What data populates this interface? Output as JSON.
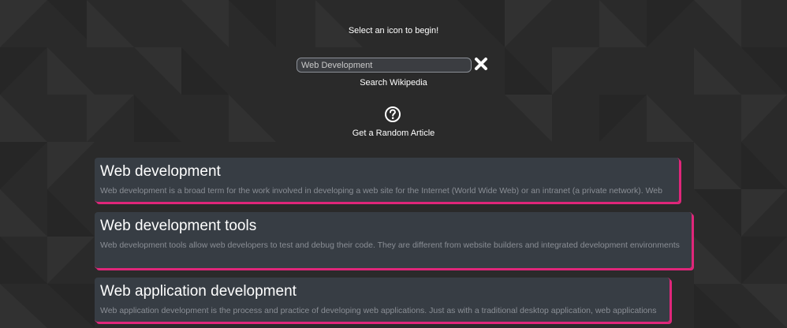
{
  "page": {
    "intro_text": "Select an icon to begin!"
  },
  "search": {
    "value": "Web Development",
    "label": "Search Wikipedia",
    "clear_icon": "close-icon"
  },
  "random": {
    "icon": "question-circle-icon",
    "label": "Get a Random Article"
  },
  "results": [
    {
      "title": "Web development",
      "snippet": "Web development is a broad term for the work involved in developing a web site for the Internet (World Wide Web) or an intranet (a private network). Web"
    },
    {
      "title": "Web development tools",
      "snippet": "Web development tools allow web developers to test and debug their code. They are different from website builders and integrated development environments"
    },
    {
      "title": "Web application development",
      "snippet": "Web application development is the process and practice of developing web applications. Just as with a traditional desktop application, web applications"
    }
  ],
  "colors": {
    "background": "#2a2a2a",
    "card_background": "#383e46",
    "accent": "#e0267a",
    "snippet_text": "#8a8e95"
  }
}
